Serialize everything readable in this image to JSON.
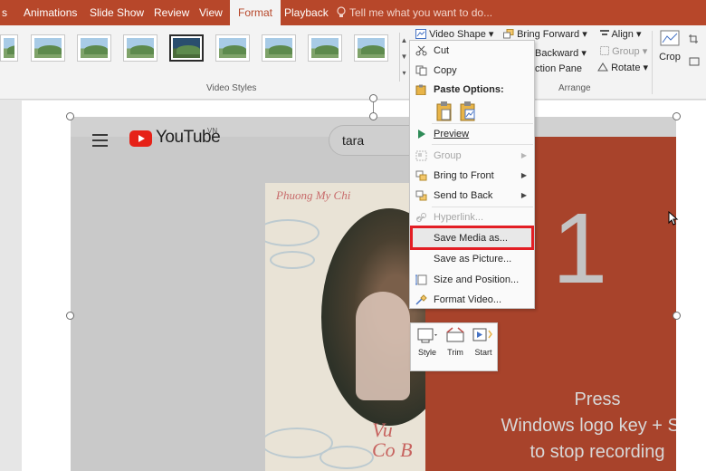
{
  "tabs": {
    "s": "s",
    "animations": "Animations",
    "slide_show": "Slide Show",
    "review": "Review",
    "view": "View",
    "format": "Format",
    "playback": "Playback"
  },
  "tell_me": "Tell me what you want to do...",
  "ribbon": {
    "video_styles_label": "Video Styles",
    "video_shape": "Video Shape",
    "bring_forward": "Bring Forward",
    "send_backward": "Backward",
    "selection_pane": "ction Pane",
    "align": "Align",
    "group": "Group",
    "rotate": "Rotate",
    "crop": "Crop",
    "arrange_label": "Arrange"
  },
  "video": {
    "brand": "YouTube",
    "region": "VN",
    "search_text": "tara",
    "artist": "Phuong My Chi",
    "title_line1": "Vu",
    "title_line2": "Co B",
    "counter": "1",
    "press_line1": "Press",
    "press_line2": "Windows logo key + Shi",
    "press_line3": "to stop recording"
  },
  "context_menu": {
    "cut": "Cut",
    "copy": "Copy",
    "paste_options": "Paste Options:",
    "preview": "Preview",
    "group": "Group",
    "bring_to_front": "Bring to Front",
    "send_to_back": "Send to Back",
    "hyperlink": "Hyperlink...",
    "save_media_as": "Save Media as...",
    "save_as_picture": "Save as Picture...",
    "size_and_position": "Size and Position...",
    "format_video": "Format Video..."
  },
  "mini_toolbar": {
    "style": "Style",
    "trim": "Trim",
    "start": "Start"
  },
  "colors": {
    "accent": "#b7472a",
    "highlight_box": "#e31e24",
    "panel": "#a8432b"
  }
}
